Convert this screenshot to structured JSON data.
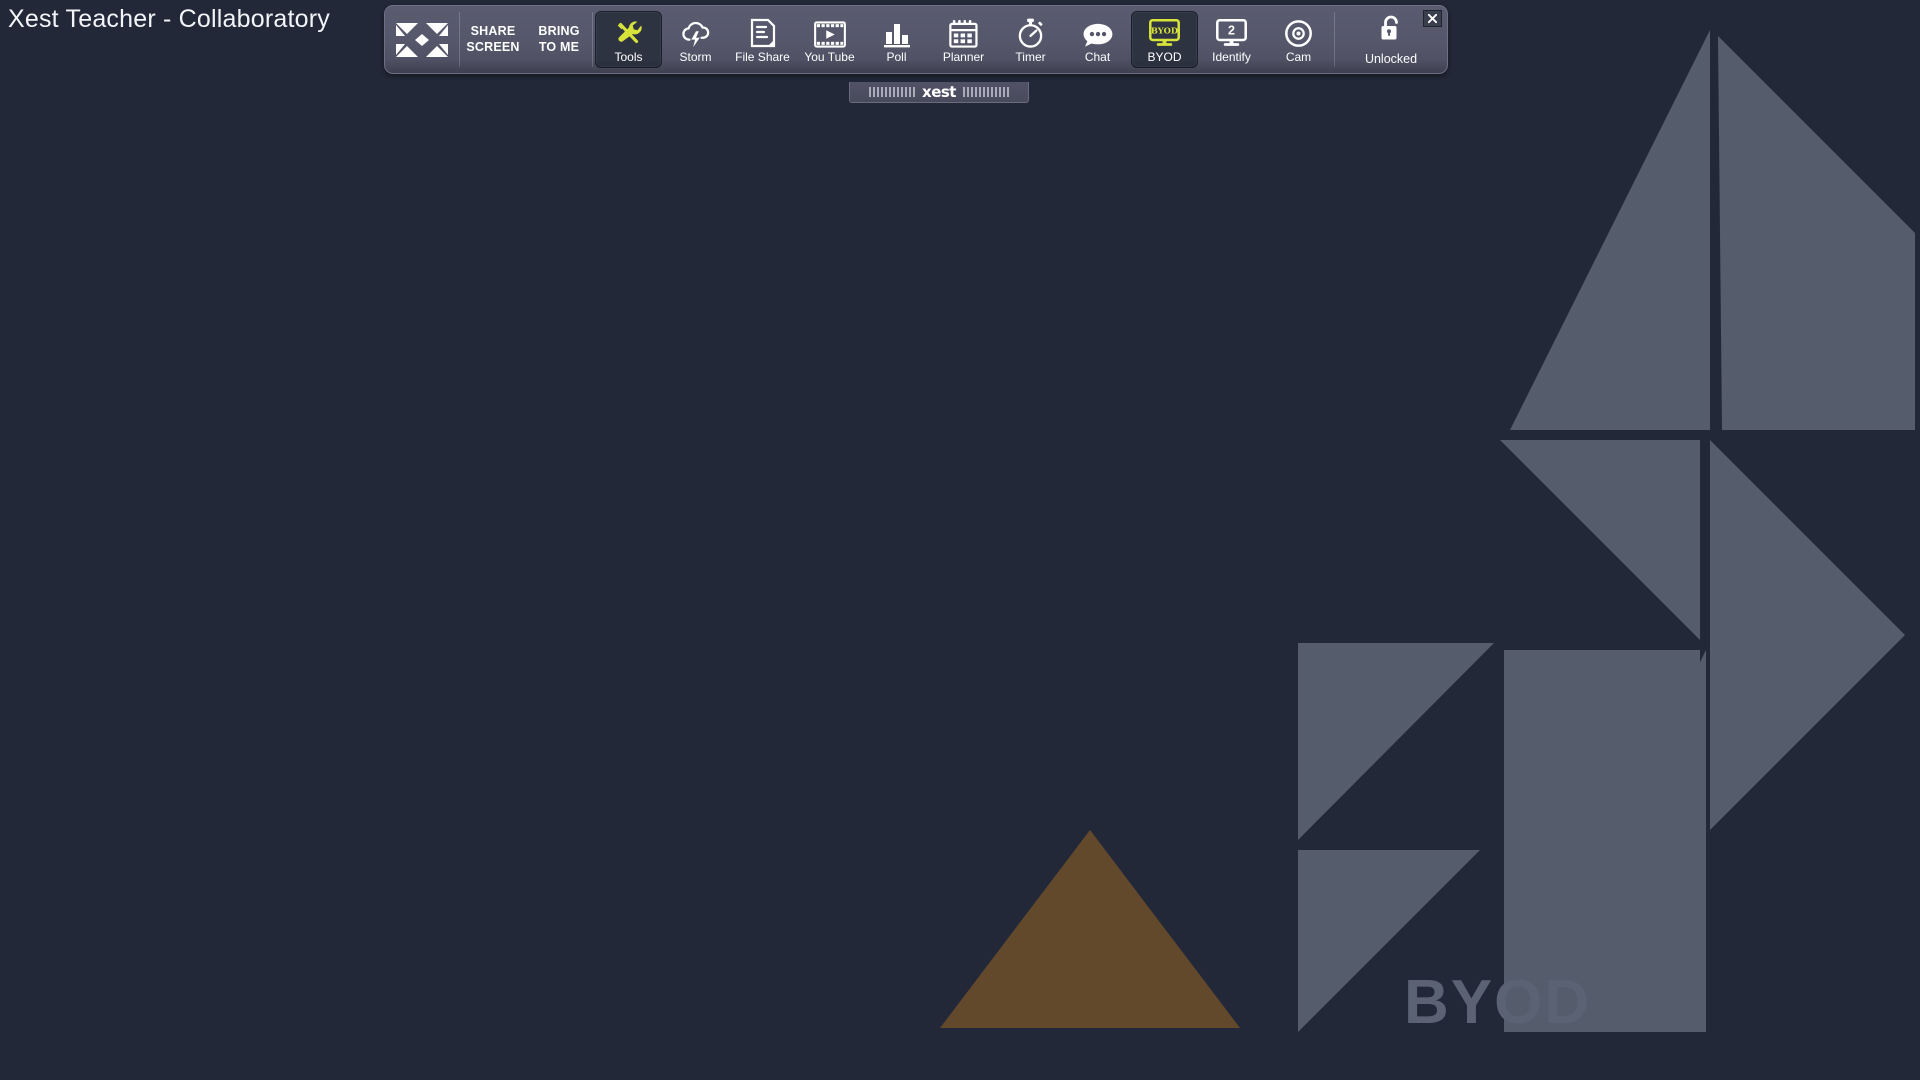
{
  "desktop": {
    "title": "Xest Teacher - Collaboratory",
    "background_color": "#222838",
    "watermark_label": "BYOD",
    "watermark_color": "#5b6274",
    "accent_color": "#d7e23a",
    "triangle_color": "#63492c"
  },
  "toolbar": {
    "logo_name": "xest-logo",
    "text_buttons": [
      {
        "line1": "SHARE",
        "line2": "SCREEN",
        "name": "share-screen"
      },
      {
        "line1": "BRING",
        "line2": "TO ME",
        "name": "bring-to-me"
      }
    ],
    "items": [
      {
        "label": "Tools",
        "icon": "tools-icon",
        "active": true
      },
      {
        "label": "Storm",
        "icon": "storm-icon",
        "active": false
      },
      {
        "label": "File Share",
        "icon": "file-share-icon",
        "active": false
      },
      {
        "label": "You Tube",
        "icon": "youtube-icon",
        "active": false
      },
      {
        "label": "Poll",
        "icon": "poll-icon",
        "active": false
      },
      {
        "label": "Planner",
        "icon": "planner-icon",
        "active": false
      },
      {
        "label": "Timer",
        "icon": "timer-icon",
        "active": false
      },
      {
        "label": "Chat",
        "icon": "chat-icon",
        "active": false
      },
      {
        "label": "BYOD",
        "icon": "byod-icon",
        "active": true
      },
      {
        "label": "Identify",
        "icon": "identify-icon",
        "active": false,
        "badge": "2"
      },
      {
        "label": "Cam",
        "icon": "cam-icon",
        "active": false
      }
    ],
    "lock": {
      "label": "Unlocked",
      "icon": "unlocked-padlock-icon"
    },
    "close": {
      "icon": "close-icon",
      "label": "X"
    }
  },
  "drag_handle": {
    "word": "xest"
  }
}
